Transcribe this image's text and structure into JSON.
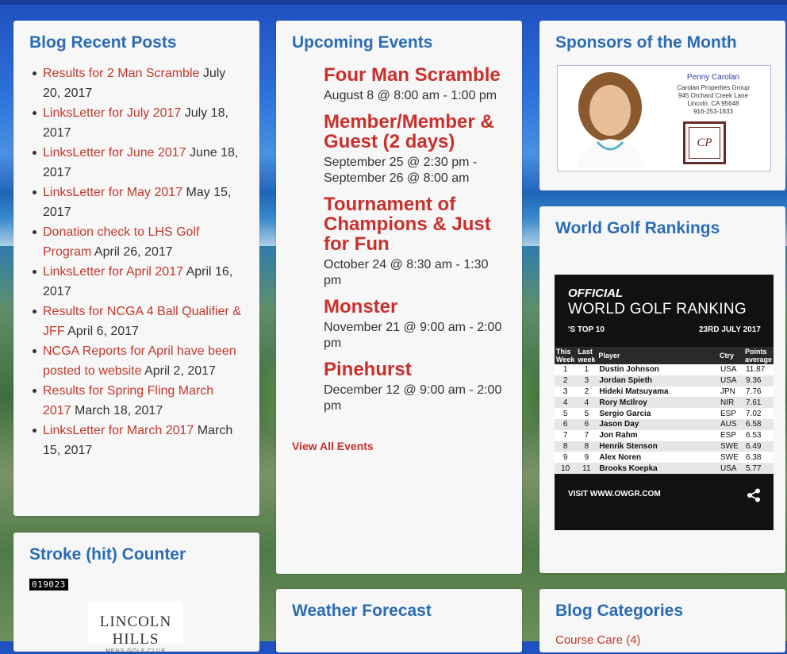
{
  "blog": {
    "title": "Blog Recent Posts",
    "posts": [
      {
        "link": "Results for 2 Man Scramble",
        "date": " July 20, 2017"
      },
      {
        "link": "LinksLetter for July 2017",
        "date": " July 18, 2017"
      },
      {
        "link": "LinksLetter for June 2017",
        "date": " June 18, 2017"
      },
      {
        "link": "LinksLetter for May 2017",
        "date": " May 15, 2017"
      },
      {
        "link": "Donation check to LHS Golf Program",
        "date": " April 26, 2017"
      },
      {
        "link": "LinksLetter for April 2017",
        "date": " April 16, 2017"
      },
      {
        "link": "Results for NCGA 4 Ball Qualifier & JFF",
        "date": " April 6, 2017"
      },
      {
        "link": "NCGA Reports for April have been posted to website",
        "date": " April 2, 2017"
      },
      {
        "link": "Results for Spring Fling March 2017",
        "date": " March 18, 2017"
      },
      {
        "link": "LinksLetter for March 2017",
        "date": " March 15, 2017"
      }
    ]
  },
  "events": {
    "title": "Upcoming Events",
    "items": [
      {
        "title": "Four Man Scramble",
        "date": "August 8 @ 8:00 am - 1:00 pm"
      },
      {
        "title": "Member/Member & Guest (2 days)",
        "date": "September 25 @ 2:30 pm - September 26 @ 8:00 am"
      },
      {
        "title": "Tournament of Champions & Just for Fun",
        "date": "October 24 @ 8:30 am - 1:30 pm"
      },
      {
        "title": "Monster",
        "date": "November 21 @ 9:00 am - 2:00 pm"
      },
      {
        "title": "Pinehurst",
        "date": "December 12 @ 9:00 am - 2:00 pm"
      }
    ],
    "view_all": "View All Events"
  },
  "sponsors": {
    "title": "Sponsors of the Month",
    "name": "Penny Carolan",
    "company": "Carolan Properties Group",
    "street": "945 Orchard Creek Lane",
    "city": "Lincoln, CA  95648",
    "phone": "916-253-1833",
    "logo_text": "CP"
  },
  "rankings": {
    "title": "World Golf Rankings",
    "official": "OFFICIAL",
    "heading": "WORLD GOLF RANKING",
    "top10": "'S TOP 10",
    "date": "23RD JULY 2017",
    "headers": {
      "this_week": "This Week",
      "last_week": "Last week",
      "player": "Player",
      "ctry": "Ctry",
      "points": "Points average"
    },
    "rows": [
      {
        "this": "1",
        "last": "1",
        "player": "Dustin Johnson",
        "ctry": "USA",
        "pts": "11.87"
      },
      {
        "this": "2",
        "last": "3",
        "player": "Jordan Spieth",
        "ctry": "USA",
        "pts": "9.36"
      },
      {
        "this": "3",
        "last": "2",
        "player": "Hideki Matsuyama",
        "ctry": "JPN",
        "pts": "7.76"
      },
      {
        "this": "4",
        "last": "4",
        "player": "Rory McIlroy",
        "ctry": "NIR",
        "pts": "7.61"
      },
      {
        "this": "5",
        "last": "5",
        "player": "Sergio Garcia",
        "ctry": "ESP",
        "pts": "7.02"
      },
      {
        "this": "6",
        "last": "6",
        "player": "Jason Day",
        "ctry": "AUS",
        "pts": "6.58"
      },
      {
        "this": "7",
        "last": "7",
        "player": "Jon Rahm",
        "ctry": "ESP",
        "pts": "6.53"
      },
      {
        "this": "8",
        "last": "8",
        "player": "Henrik Stenson",
        "ctry": "SWE",
        "pts": "6.49"
      },
      {
        "this": "9",
        "last": "9",
        "player": "Alex Noren",
        "ctry": "SWE",
        "pts": "6.38"
      },
      {
        "this": "10",
        "last": "11",
        "player": "Brooks Koepka",
        "ctry": "USA",
        "pts": "5.77"
      }
    ],
    "visit": "VISIT WWW.OWGR.COM",
    "share_icon": "share-icon"
  },
  "counter": {
    "title": "Stroke (hit) Counter",
    "value": "019023",
    "logo_line1": "LINCOLN HILLS",
    "logo_line2": "MENS GOLF CLUB"
  },
  "weather": {
    "title": "Weather Forecast"
  },
  "categories": {
    "title": "Blog Categories",
    "peek": "Course Care (4)"
  },
  "colors": {
    "heading": "#2a6cb5",
    "link": "#c0392b",
    "event": "#c9302c"
  }
}
